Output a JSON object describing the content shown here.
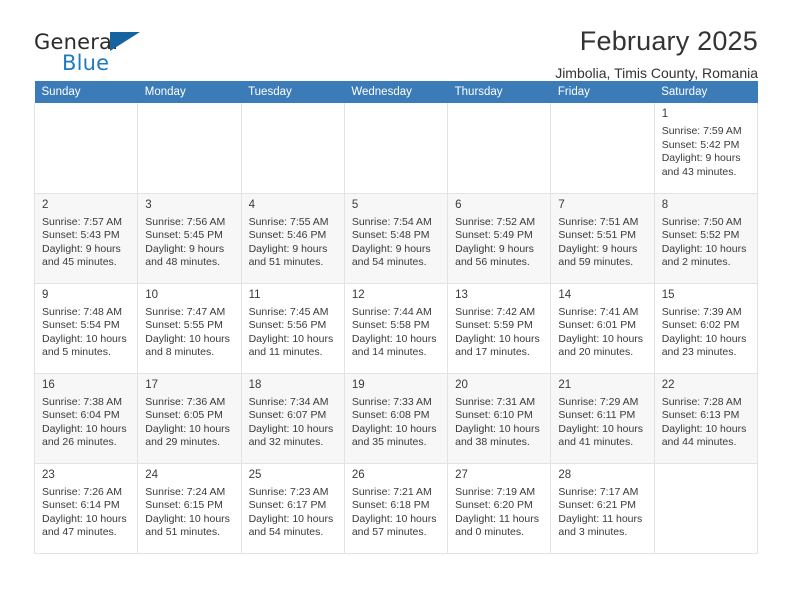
{
  "brand": {
    "name_part1": "General",
    "name_part2": "Blue",
    "mark": "triangle-logo",
    "colors": {
      "blue": "#1f7bc1",
      "dark": "#2b2b2b",
      "mark": "#15639f"
    }
  },
  "header": {
    "title": "February 2025",
    "subtitle": "Jimbolia, Timis County, Romania"
  },
  "theme": {
    "header_row_bg": "#3b7cb8",
    "header_row_text": "#ffffff",
    "alt_row_bg": "#f7f7f7",
    "grid_line": "#e3e3e3"
  },
  "weekdays": [
    "Sunday",
    "Monday",
    "Tuesday",
    "Wednesday",
    "Thursday",
    "Friday",
    "Saturday"
  ],
  "weeks": [
    [
      {
        "empty": true
      },
      {
        "empty": true
      },
      {
        "empty": true
      },
      {
        "empty": true
      },
      {
        "empty": true
      },
      {
        "empty": true
      },
      {
        "day": "1",
        "sunrise": "Sunrise: 7:59 AM",
        "sunset": "Sunset: 5:42 PM",
        "daylight1": "Daylight: 9 hours",
        "daylight2": "and 43 minutes."
      }
    ],
    [
      {
        "day": "2",
        "sunrise": "Sunrise: 7:57 AM",
        "sunset": "Sunset: 5:43 PM",
        "daylight1": "Daylight: 9 hours",
        "daylight2": "and 45 minutes."
      },
      {
        "day": "3",
        "sunrise": "Sunrise: 7:56 AM",
        "sunset": "Sunset: 5:45 PM",
        "daylight1": "Daylight: 9 hours",
        "daylight2": "and 48 minutes."
      },
      {
        "day": "4",
        "sunrise": "Sunrise: 7:55 AM",
        "sunset": "Sunset: 5:46 PM",
        "daylight1": "Daylight: 9 hours",
        "daylight2": "and 51 minutes."
      },
      {
        "day": "5",
        "sunrise": "Sunrise: 7:54 AM",
        "sunset": "Sunset: 5:48 PM",
        "daylight1": "Daylight: 9 hours",
        "daylight2": "and 54 minutes."
      },
      {
        "day": "6",
        "sunrise": "Sunrise: 7:52 AM",
        "sunset": "Sunset: 5:49 PM",
        "daylight1": "Daylight: 9 hours",
        "daylight2": "and 56 minutes."
      },
      {
        "day": "7",
        "sunrise": "Sunrise: 7:51 AM",
        "sunset": "Sunset: 5:51 PM",
        "daylight1": "Daylight: 9 hours",
        "daylight2": "and 59 minutes."
      },
      {
        "day": "8",
        "sunrise": "Sunrise: 7:50 AM",
        "sunset": "Sunset: 5:52 PM",
        "daylight1": "Daylight: 10 hours",
        "daylight2": "and 2 minutes."
      }
    ],
    [
      {
        "day": "9",
        "sunrise": "Sunrise: 7:48 AM",
        "sunset": "Sunset: 5:54 PM",
        "daylight1": "Daylight: 10 hours",
        "daylight2": "and 5 minutes."
      },
      {
        "day": "10",
        "sunrise": "Sunrise: 7:47 AM",
        "sunset": "Sunset: 5:55 PM",
        "daylight1": "Daylight: 10 hours",
        "daylight2": "and 8 minutes."
      },
      {
        "day": "11",
        "sunrise": "Sunrise: 7:45 AM",
        "sunset": "Sunset: 5:56 PM",
        "daylight1": "Daylight: 10 hours",
        "daylight2": "and 11 minutes."
      },
      {
        "day": "12",
        "sunrise": "Sunrise: 7:44 AM",
        "sunset": "Sunset: 5:58 PM",
        "daylight1": "Daylight: 10 hours",
        "daylight2": "and 14 minutes."
      },
      {
        "day": "13",
        "sunrise": "Sunrise: 7:42 AM",
        "sunset": "Sunset: 5:59 PM",
        "daylight1": "Daylight: 10 hours",
        "daylight2": "and 17 minutes."
      },
      {
        "day": "14",
        "sunrise": "Sunrise: 7:41 AM",
        "sunset": "Sunset: 6:01 PM",
        "daylight1": "Daylight: 10 hours",
        "daylight2": "and 20 minutes."
      },
      {
        "day": "15",
        "sunrise": "Sunrise: 7:39 AM",
        "sunset": "Sunset: 6:02 PM",
        "daylight1": "Daylight: 10 hours",
        "daylight2": "and 23 minutes."
      }
    ],
    [
      {
        "day": "16",
        "sunrise": "Sunrise: 7:38 AM",
        "sunset": "Sunset: 6:04 PM",
        "daylight1": "Daylight: 10 hours",
        "daylight2": "and 26 minutes."
      },
      {
        "day": "17",
        "sunrise": "Sunrise: 7:36 AM",
        "sunset": "Sunset: 6:05 PM",
        "daylight1": "Daylight: 10 hours",
        "daylight2": "and 29 minutes."
      },
      {
        "day": "18",
        "sunrise": "Sunrise: 7:34 AM",
        "sunset": "Sunset: 6:07 PM",
        "daylight1": "Daylight: 10 hours",
        "daylight2": "and 32 minutes."
      },
      {
        "day": "19",
        "sunrise": "Sunrise: 7:33 AM",
        "sunset": "Sunset: 6:08 PM",
        "daylight1": "Daylight: 10 hours",
        "daylight2": "and 35 minutes."
      },
      {
        "day": "20",
        "sunrise": "Sunrise: 7:31 AM",
        "sunset": "Sunset: 6:10 PM",
        "daylight1": "Daylight: 10 hours",
        "daylight2": "and 38 minutes."
      },
      {
        "day": "21",
        "sunrise": "Sunrise: 7:29 AM",
        "sunset": "Sunset: 6:11 PM",
        "daylight1": "Daylight: 10 hours",
        "daylight2": "and 41 minutes."
      },
      {
        "day": "22",
        "sunrise": "Sunrise: 7:28 AM",
        "sunset": "Sunset: 6:13 PM",
        "daylight1": "Daylight: 10 hours",
        "daylight2": "and 44 minutes."
      }
    ],
    [
      {
        "day": "23",
        "sunrise": "Sunrise: 7:26 AM",
        "sunset": "Sunset: 6:14 PM",
        "daylight1": "Daylight: 10 hours",
        "daylight2": "and 47 minutes."
      },
      {
        "day": "24",
        "sunrise": "Sunrise: 7:24 AM",
        "sunset": "Sunset: 6:15 PM",
        "daylight1": "Daylight: 10 hours",
        "daylight2": "and 51 minutes."
      },
      {
        "day": "25",
        "sunrise": "Sunrise: 7:23 AM",
        "sunset": "Sunset: 6:17 PM",
        "daylight1": "Daylight: 10 hours",
        "daylight2": "and 54 minutes."
      },
      {
        "day": "26",
        "sunrise": "Sunrise: 7:21 AM",
        "sunset": "Sunset: 6:18 PM",
        "daylight1": "Daylight: 10 hours",
        "daylight2": "and 57 minutes."
      },
      {
        "day": "27",
        "sunrise": "Sunrise: 7:19 AM",
        "sunset": "Sunset: 6:20 PM",
        "daylight1": "Daylight: 11 hours",
        "daylight2": "and 0 minutes."
      },
      {
        "day": "28",
        "sunrise": "Sunrise: 7:17 AM",
        "sunset": "Sunset: 6:21 PM",
        "daylight1": "Daylight: 11 hours",
        "daylight2": "and 3 minutes."
      },
      {
        "empty": true
      }
    ]
  ]
}
